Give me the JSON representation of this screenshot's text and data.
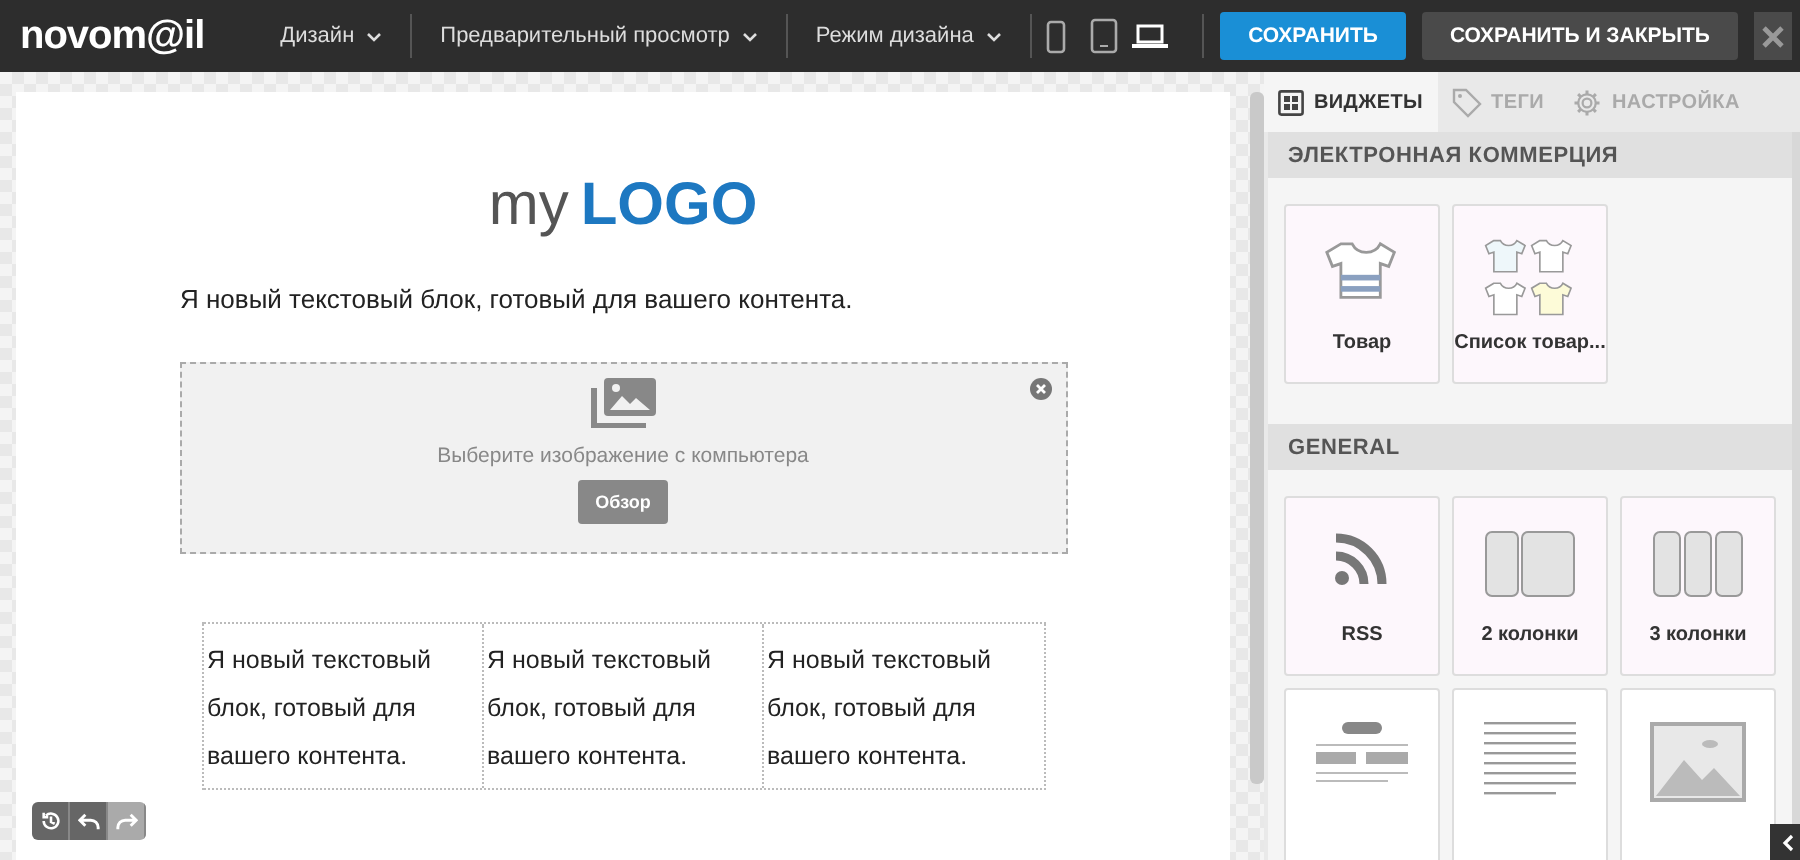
{
  "app": {
    "logo": "novom@il"
  },
  "menus": [
    {
      "label": "Дизайн"
    },
    {
      "label": "Предварительный просмотр"
    },
    {
      "label": "Режим дизайна"
    }
  ],
  "devices": [
    {
      "kind": "phone",
      "selected": false
    },
    {
      "kind": "tablet",
      "selected": false
    },
    {
      "kind": "desktop",
      "selected": true
    }
  ],
  "buttons": [
    {
      "kind": "primary",
      "label": "СОХРАНИТЬ"
    },
    {
      "kind": "secondary",
      "label": "СОХРАНИТЬ И ЗАКРЫТЬ"
    }
  ],
  "canvas": {
    "logo": {
      "prefix": "my",
      "word": "LOGO"
    },
    "intro": "Я новый текстовый блок, готовый для вашего контента.",
    "image_block": {
      "hint": "Выберите изображение с компьютера",
      "button": "Обзор"
    },
    "columns": [
      "Я новый текстовый блок, готовый для вашего контента.",
      "Я новый текстовый блок, готовый для вашего контента.",
      "Я новый текстовый блок, готовый для вашего контента."
    ],
    "history": [
      {
        "kind": "history",
        "disabled": false
      },
      {
        "kind": "undo",
        "disabled": false
      },
      {
        "kind": "redo",
        "disabled": true
      }
    ]
  },
  "panel": {
    "tabs": [
      {
        "kind": "widgets",
        "label": "ВИДЖЕТЫ",
        "selected": true
      },
      {
        "kind": "tags",
        "label": "ТЕГИ",
        "selected": false
      },
      {
        "kind": "settings",
        "label": "НАСТРОЙКА",
        "selected": false
      }
    ],
    "sections": [
      {
        "title": "ЭЛЕКТРОННАЯ КОММЕРЦИЯ",
        "widgets": [
          {
            "kind": "shirt",
            "label": "Товар"
          },
          {
            "kind": "shirts",
            "label": "Список товар..."
          }
        ]
      },
      {
        "title": "GENERAL",
        "widgets": [
          {
            "kind": "rss",
            "label": "RSS"
          },
          {
            "kind": "cols2",
            "label": "2 колонки"
          },
          {
            "kind": "cols3",
            "label": "3 колонки"
          },
          {
            "kind": "layout"
          },
          {
            "kind": "text"
          },
          {
            "kind": "image"
          }
        ]
      }
    ]
  }
}
